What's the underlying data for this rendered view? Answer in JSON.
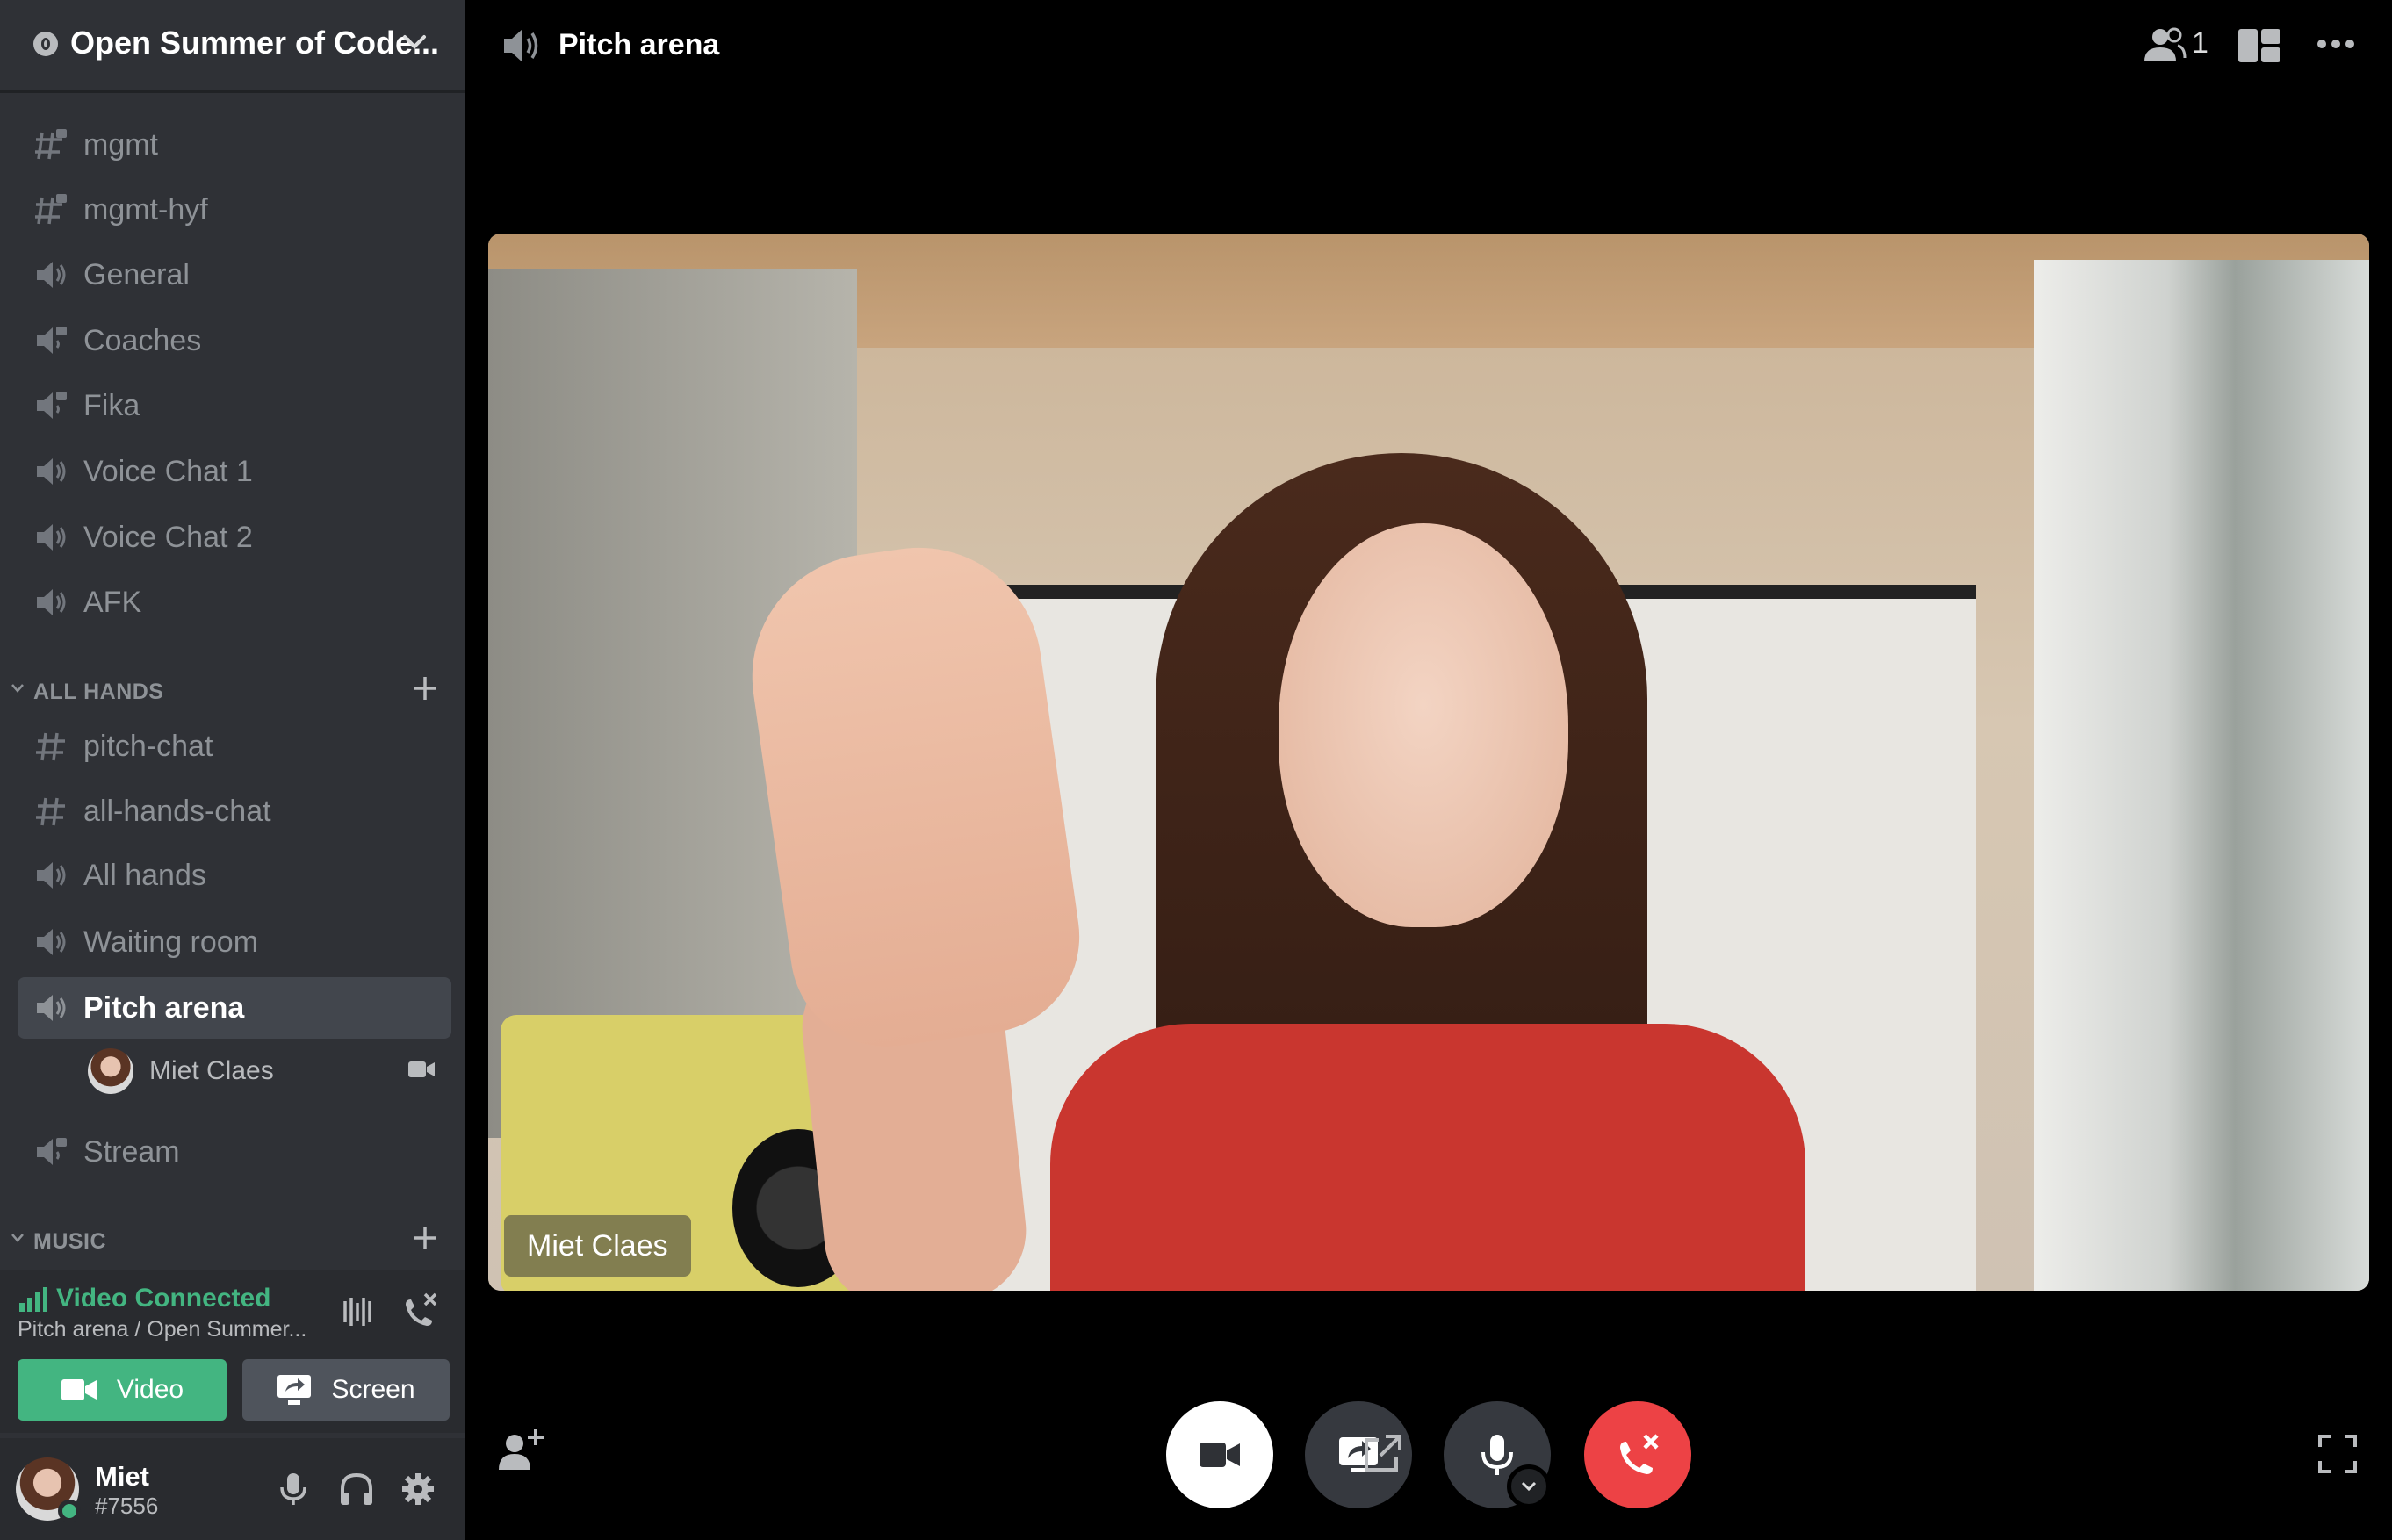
{
  "server": {
    "name": "Open Summer of Code..."
  },
  "channels_top": [
    {
      "label": "mgmt",
      "icon": "hashtag-lock-icon"
    },
    {
      "label": "mgmt-hyf",
      "icon": "hashtag-lock-icon"
    },
    {
      "label": "General",
      "icon": "speaker-icon"
    },
    {
      "label": "Coaches",
      "icon": "speaker-lock-icon"
    },
    {
      "label": "Fika",
      "icon": "speaker-lock-icon"
    },
    {
      "label": "Voice Chat 1",
      "icon": "speaker-icon"
    },
    {
      "label": "Voice Chat 2",
      "icon": "speaker-icon"
    },
    {
      "label": "AFK",
      "icon": "speaker-icon"
    }
  ],
  "categories": {
    "all_hands": "ALL HANDS",
    "music": "MUSIC"
  },
  "channels_all_hands": [
    {
      "label": "pitch-chat",
      "icon": "hashtag-icon"
    },
    {
      "label": "all-hands-chat",
      "icon": "hashtag-icon"
    },
    {
      "label": "All hands",
      "icon": "speaker-icon"
    },
    {
      "label": "Waiting room",
      "icon": "speaker-icon"
    },
    {
      "label": "Pitch arena",
      "icon": "speaker-icon",
      "selected": true
    },
    {
      "label": "Stream",
      "icon": "speaker-lock-icon"
    }
  ],
  "voice_member": {
    "name": "Miet Claes"
  },
  "voice_status": {
    "title": "Video Connected",
    "subtitle": "Pitch arena / Open Summer...",
    "video_label": "Video",
    "screen_label": "Screen"
  },
  "user": {
    "name": "Miet",
    "tag": "#7556"
  },
  "main": {
    "title": "Pitch arena",
    "member_count": "1",
    "participant_name": "Miet Claes"
  },
  "colors": {
    "sidebar": "#2f3136",
    "panel": "#292b2f",
    "connected_green": "#43b581",
    "hangup_red": "#ed4245",
    "muted_text": "#8e9297"
  }
}
